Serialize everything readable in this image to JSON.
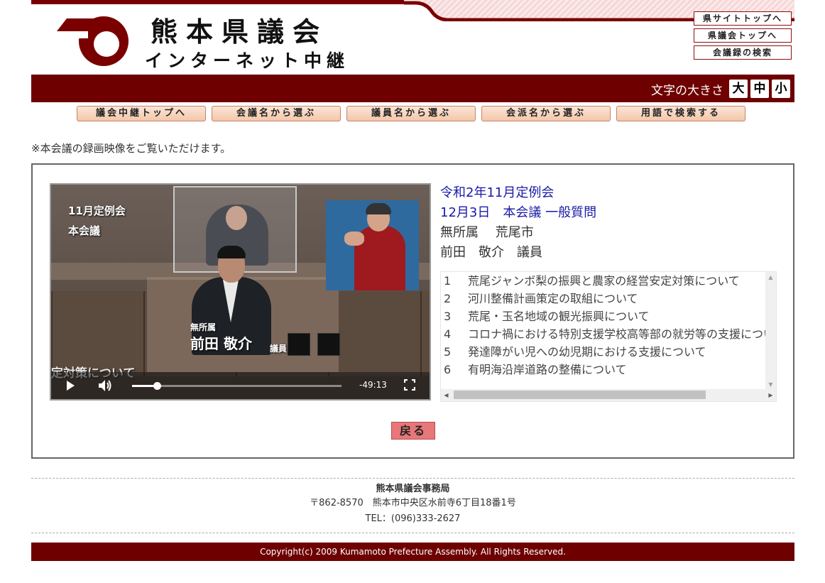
{
  "header": {
    "title": "熊本県議会",
    "subtitle": "インターネット中継",
    "links": [
      "県サイトトップへ",
      "県議会トップへ",
      "会議録の検索"
    ]
  },
  "fontsize": {
    "label": "文字の大きさ",
    "buttons": [
      "大",
      "中",
      "小"
    ]
  },
  "nav": [
    "議会中継トップへ",
    "会議名から選ぶ",
    "議員名から選ぶ",
    "会派名から選ぶ",
    "用語で検索する"
  ],
  "notice": "※本会議の録画映像をご覧いただけます。",
  "video": {
    "caption_meeting": "11月定例会",
    "caption_session": "本会議",
    "speaker_affiliation": "無所属",
    "speaker_name": "前田 敬介",
    "speaker_title": "議員",
    "subtitle_text": "定対策について",
    "time_remaining": "-49:13",
    "progress": 0.12
  },
  "info": {
    "session": "令和2年11月定例会",
    "date_meeting": "12月3日　本会議 一般質問",
    "affiliation_city": "無所属　 荒尾市",
    "member": "前田　敬介　議員"
  },
  "questions": [
    {
      "num": "1",
      "text": "荒尾ジャンボ梨の振興と農家の経営安定対策について"
    },
    {
      "num": "2",
      "text": "河川整備計画策定の取組について"
    },
    {
      "num": "3",
      "text": "荒尾・玉名地域の観光振興について"
    },
    {
      "num": "4",
      "text": "コロナ禍における特別支援学校高等部の就労等の支援について"
    },
    {
      "num": "5",
      "text": "発達障がい児への幼児期における支援について"
    },
    {
      "num": "6",
      "text": "有明海沿岸道路の整備について"
    }
  ],
  "back_label": "戻る",
  "footer": {
    "org": "熊本県議会事務局",
    "address": "〒862-8570　熊本市中央区水前寺6丁目18番1号",
    "tel": "TEL：(096)333-2627",
    "copyright": "Copyright(c) 2009 Kumamoto Prefecture Assembly. All Rights Reserved."
  },
  "colors": {
    "brand_red": "#6e0000",
    "link_blue": "#1a1aa6",
    "back_button": "#e87779"
  },
  "icons": {
    "play": "play-icon",
    "volume": "volume-icon",
    "fullscreen": "fullscreen-icon"
  }
}
